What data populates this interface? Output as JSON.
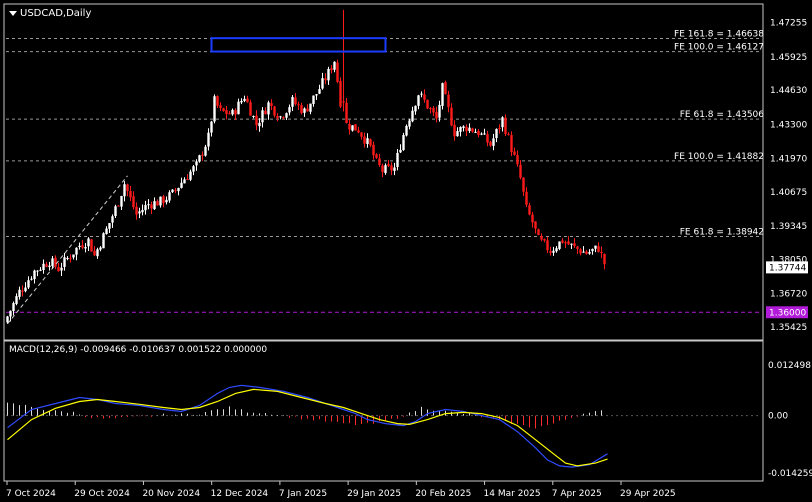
{
  "title": "USDCAD,Daily",
  "colors": {
    "background": "#000000",
    "frame": "#c8c8c8",
    "bull": "#ffffff",
    "bear": "#ff1a1a",
    "level_line": "#9a9a9a",
    "support_line": "#b01ad8",
    "current_price_bg": "#ffffff",
    "support_price_bg": "#b01ad8",
    "macd_line": "#2f4bff",
    "signal_line": "#ffff00",
    "zone_box": "#1a3cff"
  },
  "chart_data": [
    {
      "type": "candlestick",
      "title": "USDCAD,Daily",
      "price_axis_ticks": [
        "1.47255",
        "1.45925",
        "1.44630",
        "1.43300",
        "1.41970",
        "1.40675",
        "1.39345",
        "1.38050",
        "1.36720",
        "1.35425"
      ],
      "ylim": [
        1.35,
        1.479
      ],
      "x_tick_labels": [
        "7 Oct 2024",
        "29 Oct 2024",
        "20 Nov 2024",
        "12 Dec 2024",
        "7 Jan 2025",
        "29 Jan 2025",
        "20 Feb 2025",
        "14 Mar 2025",
        "7 Apr 2025",
        "29 Apr 2025"
      ],
      "current_price": "1.37744",
      "current_price_value": 1.37744,
      "support_price": "1.36000",
      "support_price_value": 1.36,
      "fibonacci_levels": [
        {
          "label": "FE 161.8 = 1.46638",
          "value": 1.46638
        },
        {
          "label": "FE 100.0 = 1.46127",
          "value": 1.46127
        },
        {
          "label": "FE 61.8 = 1.43506",
          "value": 1.43506
        },
        {
          "label": "FE 100.0 = 1.41882",
          "value": 1.41882
        },
        {
          "label": "FE 61.8 = 1.38942",
          "value": 1.38942
        }
      ],
      "resistance_zone": {
        "price_high": 1.4665,
        "price_low": 1.4613,
        "bar_start": 68,
        "bar_end": 126
      },
      "trend_line": {
        "bar_start": 0,
        "price_start": 1.3555,
        "bar_end": 40,
        "price_end": 1.413
      },
      "path_points": [
        [
          0,
          1.356
        ],
        [
          5,
          1.368
        ],
        [
          10,
          1.376
        ],
        [
          15,
          1.38
        ],
        [
          18,
          1.377
        ],
        [
          25,
          1.386
        ],
        [
          28,
          1.388
        ],
        [
          30,
          1.382
        ],
        [
          34,
          1.392
        ],
        [
          38,
          1.403
        ],
        [
          40,
          1.41
        ],
        [
          44,
          1.398
        ],
        [
          48,
          1.402
        ],
        [
          52,
          1.403
        ],
        [
          56,
          1.406
        ],
        [
          60,
          1.412
        ],
        [
          64,
          1.417
        ],
        [
          68,
          1.428
        ],
        [
          70,
          1.442
        ],
        [
          72,
          1.438
        ],
        [
          76,
          1.437
        ],
        [
          80,
          1.444
        ],
        [
          84,
          1.433
        ],
        [
          88,
          1.441
        ],
        [
          92,
          1.436
        ],
        [
          96,
          1.442
        ],
        [
          100,
          1.438
        ],
        [
          104,
          1.445
        ],
        [
          108,
          1.453
        ],
        [
          110,
          1.458
        ],
        [
          112,
          1.442
        ],
        [
          114,
          1.433
        ],
        [
          118,
          1.431
        ],
        [
          122,
          1.424
        ],
        [
          124,
          1.418
        ],
        [
          126,
          1.415
        ],
        [
          130,
          1.416
        ],
        [
          132,
          1.425
        ],
        [
          134,
          1.433
        ],
        [
          138,
          1.445
        ],
        [
          140,
          1.442
        ],
        [
          144,
          1.435
        ],
        [
          146,
          1.447
        ],
        [
          150,
          1.43
        ],
        [
          154,
          1.432
        ],
        [
          158,
          1.43
        ],
        [
          162,
          1.425
        ],
        [
          166,
          1.435
        ],
        [
          170,
          1.42
        ],
        [
          172,
          1.412
        ],
        [
          174,
          1.4
        ],
        [
          176,
          1.395
        ],
        [
          178,
          1.388
        ],
        [
          182,
          1.384
        ],
        [
          186,
          1.388
        ],
        [
          190,
          1.385
        ],
        [
          194,
          1.383
        ],
        [
          198,
          1.385
        ],
        [
          200,
          1.379
        ]
      ],
      "spike": {
        "bar": 112,
        "high": 1.4775,
        "open": 1.442,
        "close": 1.442
      }
    },
    {
      "type": "line",
      "title": "MACD(12,26,9) -0.009466 -0.010637 0.001522 0.000000",
      "axis_ticks": [
        "0.012498",
        "0.00",
        "-0.014259"
      ],
      "ylim": [
        -0.0155,
        0.0138
      ],
      "series": [
        {
          "name": "MACD",
          "points": [
            [
              0,
              -0.003
            ],
            [
              8,
              0.0015
            ],
            [
              16,
              0.003
            ],
            [
              24,
              0.0045
            ],
            [
              30,
              0.004
            ],
            [
              36,
              0.003
            ],
            [
              44,
              0.0025
            ],
            [
              52,
              0.0015
            ],
            [
              58,
              0.001
            ],
            [
              64,
              0.0025
            ],
            [
              70,
              0.0055
            ],
            [
              74,
              0.007
            ],
            [
              78,
              0.0075
            ],
            [
              84,
              0.007
            ],
            [
              92,
              0.006
            ],
            [
              100,
              0.0045
            ],
            [
              106,
              0.003
            ],
            [
              112,
              0.0015
            ],
            [
              116,
              0.0005
            ],
            [
              120,
              -0.001
            ],
            [
              126,
              -0.002
            ],
            [
              132,
              -0.0025
            ],
            [
              136,
              -0.0015
            ],
            [
              140,
              0.0005
            ],
            [
              146,
              0.0015
            ],
            [
              152,
              0.001
            ],
            [
              158,
              0.0
            ],
            [
              164,
              -0.001
            ],
            [
              170,
              -0.004
            ],
            [
              176,
              -0.008
            ],
            [
              180,
              -0.011
            ],
            [
              184,
              -0.0125
            ],
            [
              188,
              -0.0128
            ],
            [
              194,
              -0.0122
            ],
            [
              200,
              -0.0095
            ]
          ]
        },
        {
          "name": "Signal",
          "points": [
            [
              0,
              -0.006
            ],
            [
              8,
              -0.001
            ],
            [
              16,
              0.0018
            ],
            [
              24,
              0.0035
            ],
            [
              30,
              0.004
            ],
            [
              36,
              0.0035
            ],
            [
              44,
              0.0028
            ],
            [
              52,
              0.002
            ],
            [
              58,
              0.0015
            ],
            [
              64,
              0.002
            ],
            [
              70,
              0.0035
            ],
            [
              76,
              0.0055
            ],
            [
              82,
              0.0065
            ],
            [
              90,
              0.006
            ],
            [
              98,
              0.0045
            ],
            [
              106,
              0.003
            ],
            [
              112,
              0.002
            ],
            [
              118,
              0.0005
            ],
            [
              124,
              -0.001
            ],
            [
              130,
              -0.002
            ],
            [
              134,
              -0.0022
            ],
            [
              140,
              -0.001
            ],
            [
              146,
              0.0005
            ],
            [
              152,
              0.0008
            ],
            [
              158,
              0.0005
            ],
            [
              164,
              -0.0005
            ],
            [
              170,
              -0.0025
            ],
            [
              176,
              -0.006
            ],
            [
              182,
              -0.0095
            ],
            [
              186,
              -0.0118
            ],
            [
              190,
              -0.0125
            ],
            [
              196,
              -0.0118
            ],
            [
              200,
              -0.0108
            ]
          ]
        }
      ],
      "histogram_pattern": [
        [
          0,
          0.003
        ],
        [
          6,
          0.0025
        ],
        [
          14,
          0.0012
        ],
        [
          22,
          0.0008
        ],
        [
          28,
          -0.0005
        ],
        [
          34,
          -0.0008
        ],
        [
          40,
          -0.0005
        ],
        [
          46,
          -0.0003
        ],
        [
          52,
          0.0002
        ],
        [
          58,
          0.0003
        ],
        [
          64,
          0.0005
        ],
        [
          70,
          0.0015
        ],
        [
          74,
          0.002
        ],
        [
          80,
          0.001
        ],
        [
          88,
          0.0005
        ],
        [
          96,
          -0.0005
        ],
        [
          104,
          -0.0012
        ],
        [
          110,
          -0.0018
        ],
        [
          116,
          -0.0022
        ],
        [
          122,
          -0.002
        ],
        [
          128,
          -0.001
        ],
        [
          134,
          0.0005
        ],
        [
          138,
          0.002
        ],
        [
          142,
          0.0015
        ],
        [
          148,
          0.0008
        ],
        [
          154,
          0.0003
        ],
        [
          160,
          -0.0005
        ],
        [
          166,
          -0.0015
        ],
        [
          172,
          -0.0025
        ],
        [
          176,
          -0.003
        ],
        [
          182,
          -0.002
        ],
        [
          188,
          -0.0005
        ],
        [
          194,
          0.001
        ],
        [
          200,
          0.0012
        ]
      ]
    }
  ]
}
